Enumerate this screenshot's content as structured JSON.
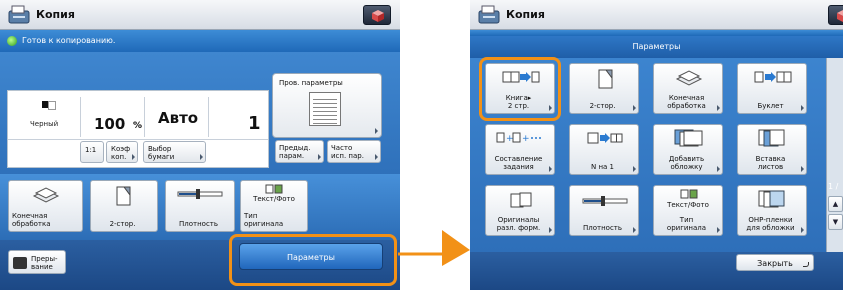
{
  "left_screen": {
    "title": "Копия",
    "status": "Готов к копированию.",
    "color_mode": "Черный",
    "zoom_value": "100",
    "zoom_unit": "%",
    "paper_value": "Авто",
    "copies": "1",
    "check_settings_label": "Пров. параметры",
    "buttons": {
      "ratio_1to1": "1:1",
      "zoom_ratio": "Коэф\nкоп.",
      "paper_select": "Выбор\nбумаги",
      "previous_settings": "Предыд.\nпарам.",
      "frequent_settings": "Часто\nисп. пар."
    },
    "function_tiles": [
      {
        "label": "Конечная\nобработка",
        "icon": "finishing-icon"
      },
      {
        "label": "2-стор.",
        "icon": "duplex-icon"
      },
      {
        "label": "Плотность",
        "icon": "density-slider-icon"
      },
      {
        "label": "Тип\nоригинала",
        "icon": "text-photo-icon",
        "sublabel": "Текст/Фото"
      }
    ],
    "interrupt_label": "Преры-\nвание",
    "options_button": "Параметры"
  },
  "right_screen": {
    "title": "Копия",
    "header": "Параметры",
    "page_indicator": "1 /",
    "close_button": "Закрыть",
    "tiles": [
      {
        "label": "Книга▸\n2 стр.",
        "icon": "book-to-two-pages-icon"
      },
      {
        "label": "2-стор.",
        "icon": "duplex-icon"
      },
      {
        "label": "Конечная\nобработка",
        "icon": "finishing-icon"
      },
      {
        "label": "Буклет",
        "icon": "booklet-icon"
      },
      {
        "label": "Составление\nзадания",
        "icon": "job-build-icon"
      },
      {
        "label": "N на 1",
        "icon": "n-on-1-icon"
      },
      {
        "label": "Добавить\nобложку",
        "icon": "add-cover-icon"
      },
      {
        "label": "Вставка\nлистов",
        "icon": "insert-sheets-icon"
      },
      {
        "label": "Оригиналы\nразл. форм.",
        "icon": "different-size-originals-icon"
      },
      {
        "label": "Плотность",
        "icon": "density-slider-icon"
      },
      {
        "label": "Тип\nоригинала",
        "icon": "text-photo-icon",
        "sublabel": "Текст/Фото"
      },
      {
        "label": "ОНР-пленки\nдля обложки",
        "icon": "ohp-cover-icon"
      }
    ]
  },
  "colors": {
    "accent_orange": "#f29117",
    "status_blue": "#1f69b8",
    "button_blue": "#2066bb"
  }
}
